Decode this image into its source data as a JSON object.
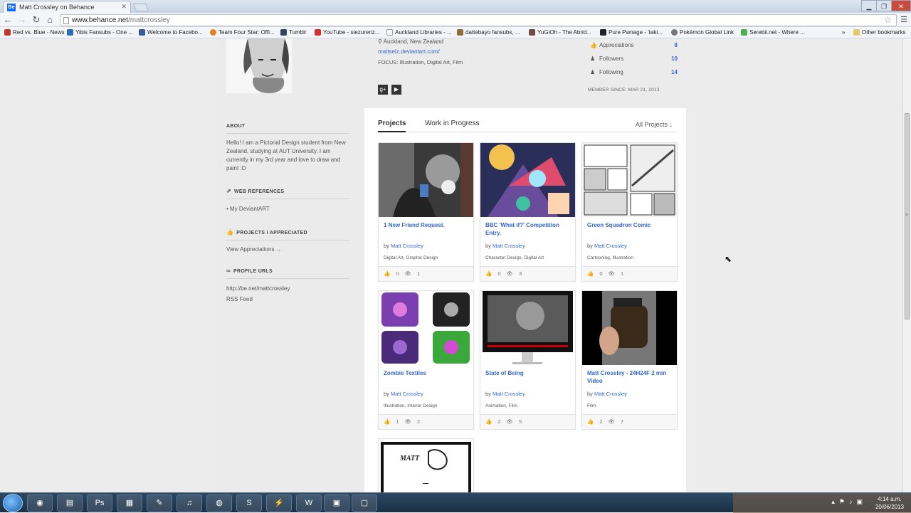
{
  "browser": {
    "tab_title": "Matt Crossley on Behance",
    "tab_favicon": "Be",
    "url_domain": "www.behance.net",
    "url_path": "/mattcrossley"
  },
  "bookmarks": [
    {
      "label": "Red vs. Blue - News",
      "color": "#c0392b"
    },
    {
      "label": "Yibis Fansubs - One ...",
      "color": "#2c6ebd"
    },
    {
      "label": "Welcome to Facebo...",
      "color": "#3b5998"
    },
    {
      "label": "Team Four Star: Offi...",
      "color": "#e67e22"
    },
    {
      "label": "Tumblr",
      "color": "#2c4762"
    },
    {
      "label": "YouTube - siezurenz...",
      "color": "#d32f2f"
    },
    {
      "label": "Auckland Libraries - ...",
      "color": "#999999"
    },
    {
      "label": "dattebayo fansubs, ...",
      "color": "#8a6d3b"
    },
    {
      "label": "YuGiOh - The Abrid...",
      "color": "#6d4c41"
    },
    {
      "label": "Pure Pwnage - 'taki...",
      "color": "#222222"
    },
    {
      "label": "Pokémon Global Link",
      "color": "#777777"
    },
    {
      "label": "Serebii.net - Where ...",
      "color": "#4caf50"
    }
  ],
  "other_bookmarks": "Other bookmarks",
  "profile": {
    "location": "Auckland, New Zealand",
    "website": "mattseiz.deviantart.com/",
    "focus": "FOCUS: Illustration, Digital Art, Film",
    "stats": [
      {
        "label": "Appreciations",
        "value": "8",
        "icon": "thumbs-up-icon"
      },
      {
        "label": "Followers",
        "value": "10",
        "icon": "person-icon"
      },
      {
        "label": "Following",
        "value": "14",
        "icon": "person-icon"
      }
    ],
    "member_since": "MEMBER SINCE: MAR 21, 2013"
  },
  "sidebar": {
    "about_heading": "ABOUT",
    "about_text": "Hello! I am a Pictorial Design student from New Zealand, studying at AUT University. I am currently in my 3rd year and love to draw and paint :D",
    "web_ref_heading": "WEB REFERENCES",
    "web_ref_link": "My DeviantART",
    "appreciated_heading": "PROJECTS I APPRECIATED",
    "view_appreciations": "View Appreciations →",
    "profile_urls_heading": "PROFILE URLS",
    "profile_url": "http://be.net/mattcrossley",
    "rss": "RSS Feed"
  },
  "tabs": {
    "projects": "Projects",
    "wip": "Work in Progress",
    "filter": "All Projects ↓"
  },
  "projects": [
    {
      "title": "1 New Friend Request.",
      "by": "by",
      "owner": "Matt Crossley",
      "fields": "Digital Art, Graphic Design",
      "likes": "0",
      "views": "1"
    },
    {
      "title": "BBC 'What if?' Competition Entry.",
      "by": "by",
      "owner": "Matt Crossley",
      "fields": "Character Design, Digital Art",
      "likes": "0",
      "views": "3"
    },
    {
      "title": "Green Squadron Comic",
      "by": "by",
      "owner": "Matt Crossley",
      "fields": "Cartooning, Illustration",
      "likes": "0",
      "views": "1"
    },
    {
      "title": "Zombie Textiles",
      "by": "by",
      "owner": "Matt Crossley",
      "fields": "Illustration, Interior Design",
      "likes": "1",
      "views": "2"
    },
    {
      "title": "State of Being",
      "by": "by",
      "owner": "Matt Crossley",
      "fields": "Animation, Film",
      "likes": "2",
      "views": "5"
    },
    {
      "title": "Matt Crossley - 24H24F 2 min Video",
      "by": "by",
      "owner": "Matt Crossley",
      "fields": "Film",
      "likes": "2",
      "views": "7"
    }
  ],
  "last_thumb_text": "MATT",
  "taskbar": {
    "clock_time": "4:14 a.m.",
    "clock_date": "20/06/2013"
  }
}
